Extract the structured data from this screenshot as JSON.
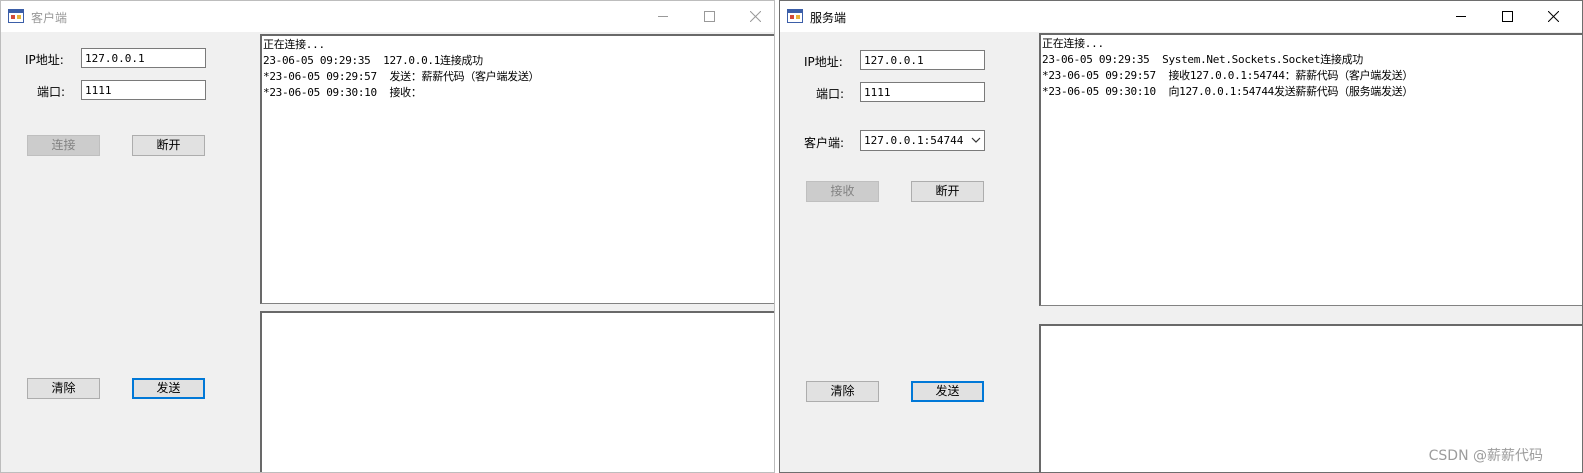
{
  "client": {
    "title": "客户端",
    "ip_label": "IP地址:",
    "ip_value": "127.0.0.1",
    "port_label": "端口:",
    "port_value": "1111",
    "connect_label": "连接",
    "disconnect_label": "断开",
    "clear_label": "清除",
    "send_label": "发送",
    "log": [
      "正在连接...",
      "23-06-05 09:29:35  127.0.0.1连接成功",
      "*23-06-05 09:29:57  发送：薪薪代码（客户端发送）",
      "*23-06-05 09:30:10  接收："
    ],
    "send_text": ""
  },
  "server": {
    "title": "服务端",
    "ip_label": "IP地址:",
    "ip_value": "127.0.0.1",
    "port_label": "端口:",
    "port_value": "1111",
    "client_label": "客户端:",
    "client_value": "127.0.0.1:54744",
    "receive_label": "接收",
    "disconnect_label": "断开",
    "clear_label": "清除",
    "send_label": "发送",
    "log": [
      "正在连接...",
      "23-06-05 09:29:35  System.Net.Sockets.Socket连接成功",
      "*23-06-05 09:29:57  接收127.0.0.1:54744：薪薪代码（客户端发送）",
      "*23-06-05 09:30:10  向127.0.0.1:54744发送薪薪代码（服务端发送）"
    ],
    "send_text": ""
  },
  "watermark": "CSDN @薪薪代码",
  "icons": {
    "app": "winforms-app-icon",
    "minimize": "minimize-icon",
    "maximize": "maximize-icon",
    "close": "close-icon",
    "dropdown": "chevron-down-icon"
  }
}
